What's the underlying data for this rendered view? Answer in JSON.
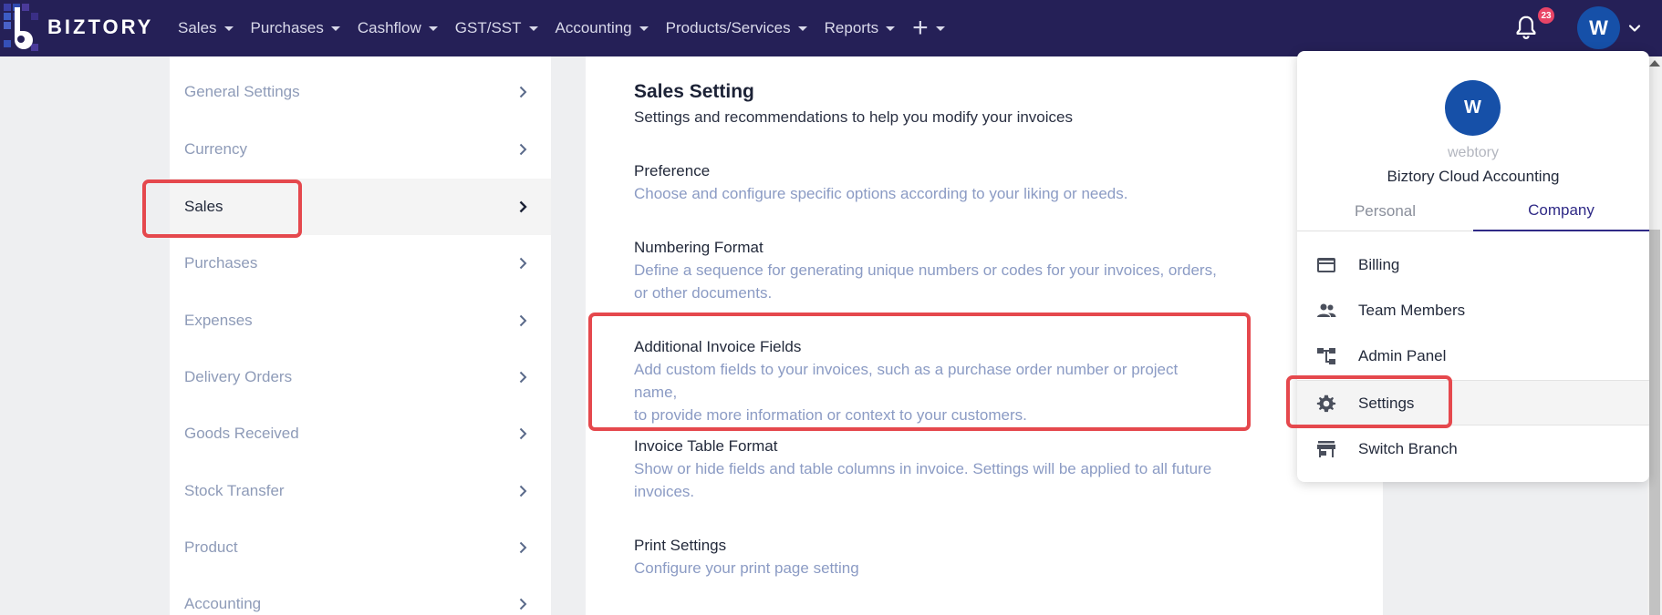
{
  "brand": {
    "name": "BIZTORY"
  },
  "nav": {
    "menu": [
      {
        "label": "Sales"
      },
      {
        "label": "Purchases"
      },
      {
        "label": "Cashflow"
      },
      {
        "label": "GST/SST"
      },
      {
        "label": "Accounting"
      },
      {
        "label": "Products/Services"
      },
      {
        "label": "Reports"
      }
    ],
    "plus_label": "+",
    "notification_count": "23",
    "avatar_letter": "W"
  },
  "settings_menu": {
    "items": [
      {
        "label": "General Settings"
      },
      {
        "label": "Currency"
      },
      {
        "label": "Sales"
      },
      {
        "label": "Purchases"
      },
      {
        "label": "Expenses"
      },
      {
        "label": "Delivery Orders"
      },
      {
        "label": "Goods Received"
      },
      {
        "label": "Stock Transfer"
      },
      {
        "label": "Product"
      },
      {
        "label": "Accounting"
      }
    ],
    "active_index": 2
  },
  "main": {
    "title": "Sales Setting",
    "subtitle": "Settings and recommendations to help you modify your invoices",
    "options": [
      {
        "title": "Preference",
        "desc1": "Choose and configure specific options according to your liking or needs.",
        "desc2": ""
      },
      {
        "title": "Numbering Format",
        "desc1": "Define a sequence for generating unique numbers or codes for your invoices, orders,",
        "desc2": "or other documents."
      },
      {
        "title": "Additional Invoice Fields",
        "desc1": "Add custom fields to your invoices, such as a purchase order number or project name,",
        "desc2": "to provide more information or context to your customers."
      },
      {
        "title": "Invoice Table Format",
        "desc1": "Show or hide fields and table columns in invoice. Settings will be applied to all future",
        "desc2": "invoices."
      },
      {
        "title": "Print Settings",
        "desc1": "Configure your print page setting",
        "desc2": ""
      }
    ]
  },
  "account_dropdown": {
    "avatar_letter": "W",
    "username": "webtory",
    "company": "Biztory Cloud Accounting",
    "tabs": [
      {
        "label": "Personal"
      },
      {
        "label": "Company"
      }
    ],
    "active_tab": "Company",
    "items": [
      {
        "label": "Billing",
        "icon": "credit-card-icon"
      },
      {
        "label": "Team Members",
        "icon": "people-icon"
      },
      {
        "label": "Admin Panel",
        "icon": "hierarchy-icon"
      },
      {
        "label": "Settings",
        "icon": "gear-icon"
      },
      {
        "label": "Switch Branch",
        "icon": "store-icon"
      }
    ],
    "active_item": "Settings"
  },
  "colors": {
    "nav_bg": "#252057",
    "accent": "#2f2a86",
    "avatar_bg": "#1650a8",
    "badge": "#e94467",
    "highlight": "#e5484d",
    "muted_text": "#8b9bc4"
  }
}
